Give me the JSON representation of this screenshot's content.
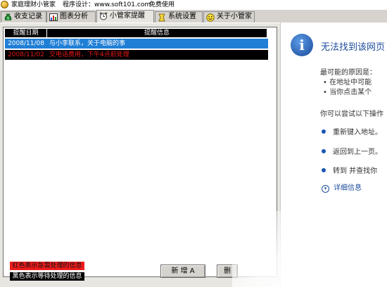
{
  "titlebar": {
    "app_name": "家庭理财小管家",
    "designer": "程序设计：www.soft101.com",
    "license": "免费使用"
  },
  "tabs": [
    {
      "label": "收支记录",
      "icon": "money-bag-icon",
      "active": false
    },
    {
      "label": "图表分析",
      "icon": "chart-icon",
      "active": false
    },
    {
      "label": "小管家提醒",
      "icon": "alarm-clock-icon",
      "active": true
    },
    {
      "label": "系统设置",
      "icon": "settings-icon",
      "active": false
    },
    {
      "label": "关于小管家",
      "icon": "smiley-icon",
      "active": false
    }
  ],
  "reminders": {
    "columns": [
      "提醒日期",
      "提醒信息"
    ],
    "rows": [
      {
        "date": "2008/11/08",
        "message": "与小李联系，关于电脑的事",
        "state": "selected"
      },
      {
        "date": "2008/11/02",
        "message": "交电话费用，下午4点前处理",
        "state": "urgent"
      }
    ]
  },
  "legend": {
    "red": "红色表示急需处理的信息",
    "black": "黑色表示等待处理的信息"
  },
  "buttons": {
    "add": "新 增 A",
    "delete": "删"
  },
  "error_page": {
    "title": "无法找到该网页",
    "causes_heading": "最可能的原因是：",
    "causes": [
      "在地址中可能",
      "当你点击某个"
    ],
    "try_heading": "你可以尝试以下操作",
    "actions": [
      "重新键入地址。",
      "返回到上一页。",
      "转到  并查找你"
    ],
    "more_info": "详细信息"
  },
  "colors": {
    "selection": "#1f7fd6",
    "urgent_text": "#e81919",
    "legend_red": "#ee1c1c",
    "link_blue": "#1e4d9c"
  }
}
